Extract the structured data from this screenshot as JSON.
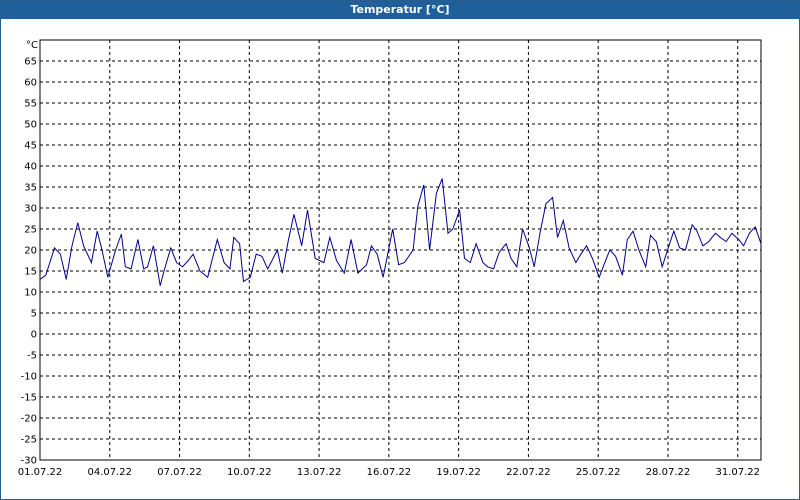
{
  "window": {
    "title": "Temperatur [°C]"
  },
  "colors": {
    "title_bar": "#1f5f9a",
    "series_line": "#00008b",
    "grid": "#000000",
    "background": "#ffffff"
  },
  "chart_data": {
    "type": "line",
    "title": "Temperatur [°C]",
    "unit_label": "°C",
    "grid": "dashed, on",
    "ylim": [
      -30,
      70
    ],
    "yticks": [
      65,
      60,
      55,
      50,
      45,
      40,
      35,
      30,
      25,
      20,
      15,
      10,
      5,
      0,
      -5,
      -10,
      -15,
      -20,
      -25,
      -30
    ],
    "xlim": [
      "01.07.22",
      "01.08.22"
    ],
    "xticks": [
      "01.07.22",
      "04.07.22",
      "07.07.22",
      "10.07.22",
      "13.07.22",
      "16.07.22",
      "19.07.22",
      "22.07.22",
      "25.07.22",
      "28.07.22",
      "31.07.22"
    ],
    "series": [
      {
        "x": [
          "01.07.22 00:00",
          "01.07.22 06:00",
          "01.07.22 15:00",
          "01.07.22 21:00",
          "02.07.22 03:00",
          "02.07.22 09:00",
          "02.07.22 15:00",
          "02.07.22 21:00",
          "03.07.22 05:00",
          "03.07.22 11:00",
          "03.07.22 16:00",
          "03.07.22 22:00",
          "04.07.22 06:00",
          "04.07.22 12:00",
          "04.07.22 16:00",
          "04.07.22 22:00",
          "05.07.22 05:00",
          "05.07.22 11:00",
          "05.07.22 15:00",
          "05.07.22 21:00",
          "06.07.22 04:00",
          "06.07.22 08:00",
          "06.07.22 15:00",
          "06.07.22 21:00",
          "07.07.22 03:00",
          "07.07.22 09:00",
          "07.07.22 14:00",
          "07.07.22 21:00",
          "08.07.22 05:00",
          "08.07.22 10:00",
          "08.07.22 15:00",
          "08.07.22 22:00",
          "09.07.22 04:00",
          "09.07.22 08:00",
          "09.07.22 14:00",
          "09.07.22 18:00",
          "10.07.22 01:00",
          "10.07.22 07:00",
          "10.07.22 13:00",
          "10.07.22 19:00",
          "11.07.22 05:00",
          "11.07.22 10:00",
          "11.07.22 16:00",
          "11.07.22 22:00",
          "12.07.22 06:00",
          "12.07.22 12:00",
          "12.07.22 20:00",
          "13.07.22 05:00",
          "13.07.22 11:00",
          "13.07.22 18:00",
          "14.07.22 02:00",
          "14.07.22 09:00",
          "14.07.22 16:00",
          "15.07.22 01:00",
          "15.07.22 06:00",
          "15.07.22 12:00",
          "15.07.22 18:00",
          "16.07.22 04:00",
          "16.07.22 10:00",
          "16.07.22 16:00",
          "17.07.22 01:00",
          "17.07.22 06:00",
          "17.07.22 12:00",
          "17.07.22 18:00",
          "18.07.22 01:00",
          "18.07.22 07:00",
          "18.07.22 13:00",
          "18.07.22 18:00",
          "19.07.22 01:00",
          "19.07.22 06:00",
          "19.07.22 12:00",
          "19.07.22 18:00",
          "20.07.22 01:00",
          "20.07.22 06:00",
          "20.07.22 12:00",
          "20.07.22 18:00",
          "21.07.22 01:00",
          "21.07.22 06:00",
          "21.07.22 12:00",
          "21.07.22 18:00",
          "22.07.22 01:00",
          "22.07.22 06:00",
          "22.07.22 12:00",
          "22.07.22 18:00",
          "23.07.22 01:00",
          "23.07.22 06:00",
          "23.07.22 12:00",
          "23.07.22 18:00",
          "24.07.22 01:00",
          "24.07.22 06:00",
          "24.07.22 12:00",
          "24.07.22 18:00",
          "25.07.22 01:00",
          "25.07.22 06:00",
          "25.07.22 12:00",
          "25.07.22 18:00",
          "26.07.22 01:00",
          "26.07.22 06:00",
          "26.07.22 12:00",
          "26.07.22 18:00",
          "27.07.22 01:00",
          "27.07.22 06:00",
          "27.07.22 12:00",
          "27.07.22 18:00",
          "28.07.22 01:00",
          "28.07.22 06:00",
          "28.07.22 12:00",
          "28.07.22 18:00",
          "29.07.22 01:00",
          "29.07.22 06:00",
          "29.07.22 12:00",
          "29.07.22 18:00",
          "30.07.22 01:00",
          "30.07.22 06:00",
          "30.07.22 12:00",
          "30.07.22 18:00",
          "31.07.22 01:00",
          "31.07.22 06:00",
          "31.07.22 12:00",
          "31.07.22 18:00",
          "01.08.22 00:00"
        ],
        "y": [
          13,
          14,
          20.5,
          19,
          13,
          21,
          26.5,
          21,
          17,
          24.5,
          20,
          13.5,
          20,
          23.8,
          16,
          15.5,
          22.5,
          15.5,
          16,
          21,
          11.5,
          15,
          20.5,
          17,
          16,
          17.5,
          19,
          15,
          13.5,
          18,
          22.5,
          17,
          15.5,
          23,
          21.5,
          12.5,
          13.5,
          19,
          18.5,
          15.5,
          20,
          14.5,
          22,
          28.5,
          21,
          29.5,
          18,
          17,
          23,
          17.5,
          14.5,
          22.5,
          14.5,
          16.5,
          21,
          19,
          13.5,
          25,
          16.5,
          17,
          20,
          30.5,
          35.5,
          20,
          33.5,
          37,
          24,
          25,
          29.5,
          18,
          17,
          21.5,
          17,
          16,
          15.5,
          19.5,
          21.5,
          18,
          16,
          25,
          20.5,
          16,
          24,
          31,
          32.5,
          23,
          27,
          20.5,
          17,
          19,
          21,
          18,
          13.5,
          16.5,
          20,
          18.5,
          14,
          22.5,
          24.5,
          20,
          16,
          23.5,
          22,
          16,
          21,
          24.5,
          20.5,
          20,
          26,
          24.5,
          21,
          22,
          24,
          23,
          22,
          24,
          22.5,
          21,
          24,
          25.5,
          21.5
        ]
      }
    ]
  }
}
